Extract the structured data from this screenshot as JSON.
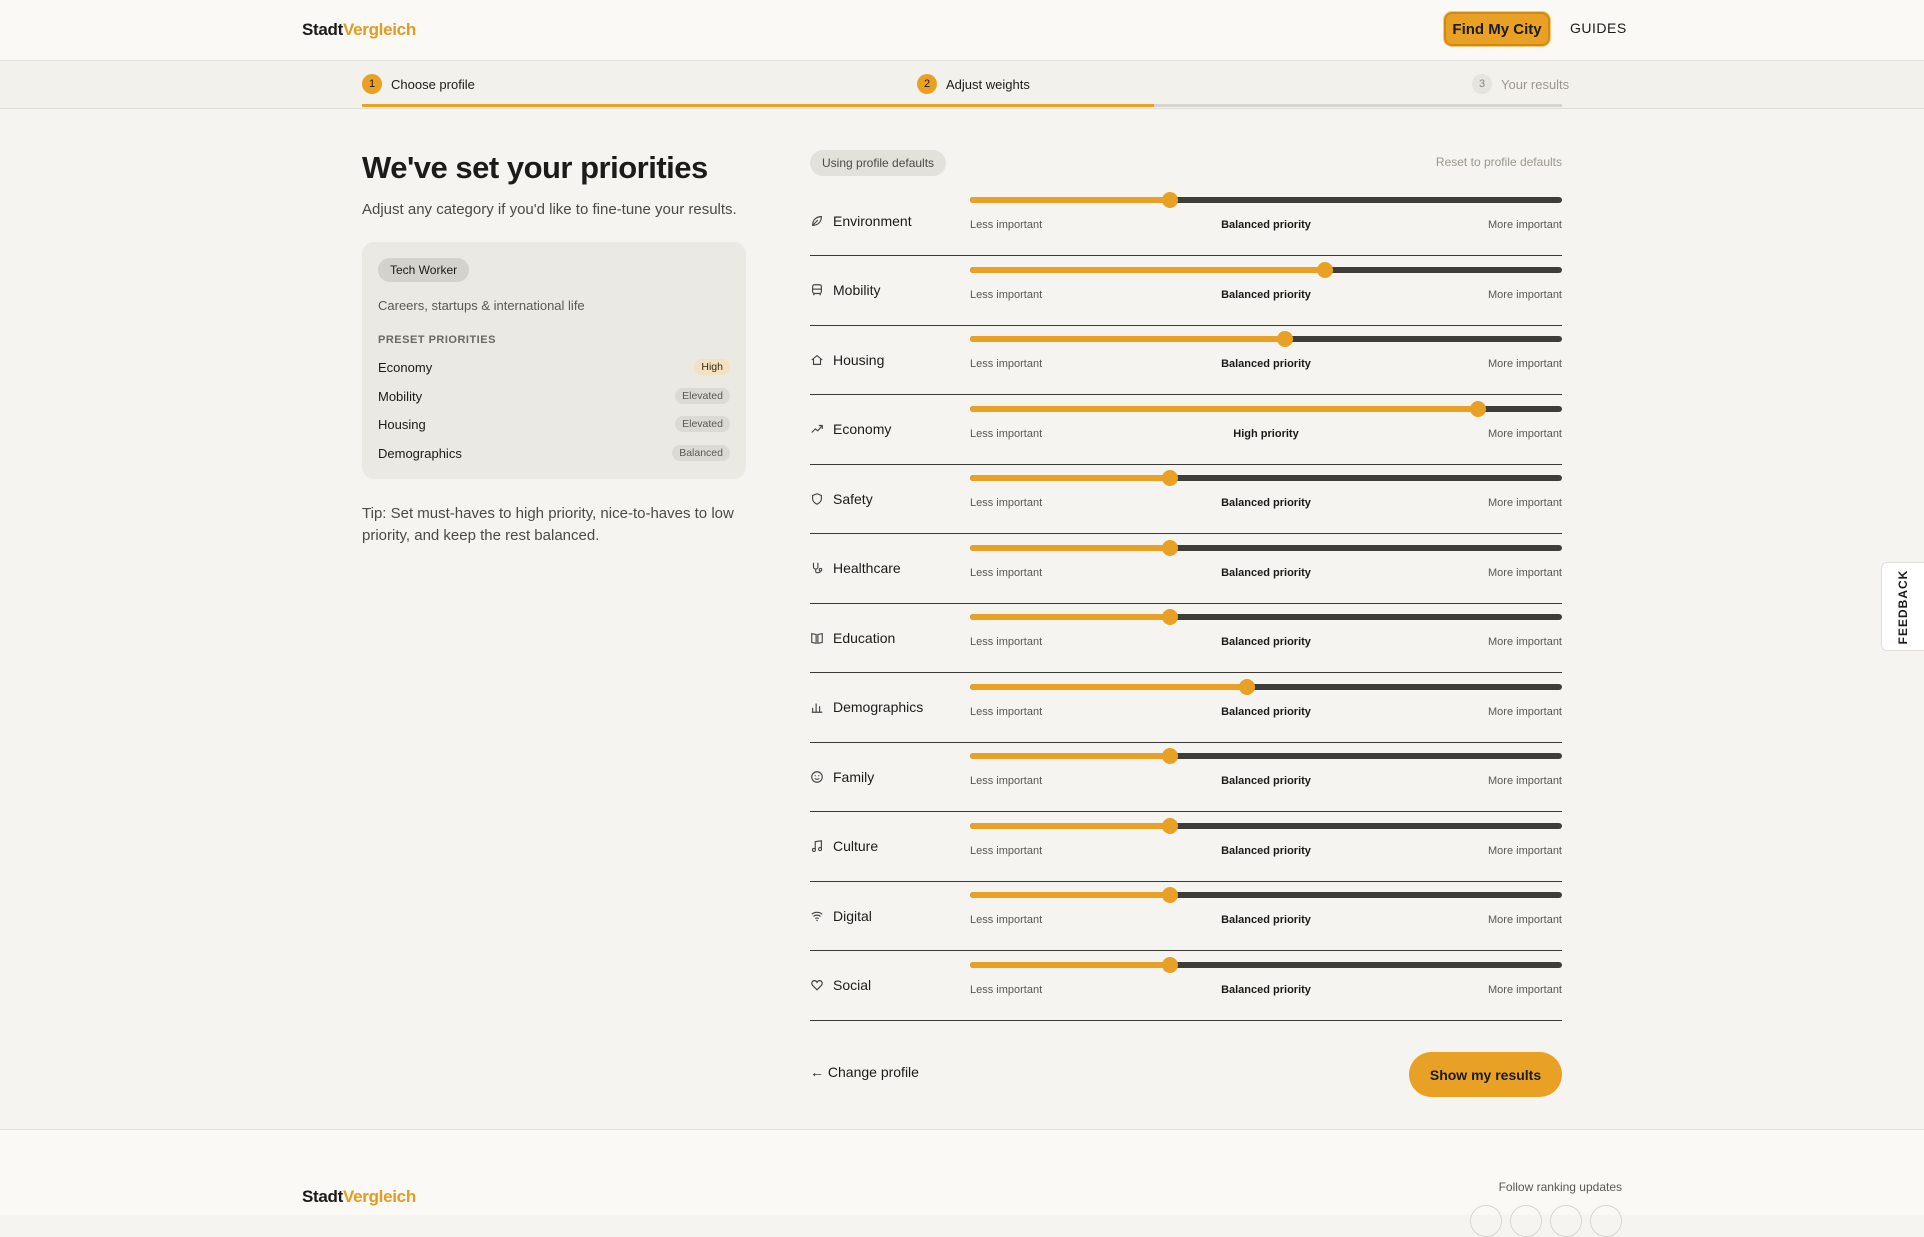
{
  "header": {
    "logo_a": "Stadt",
    "logo_b": "Vergleich",
    "find_label": "Find My City",
    "guides_label": "GUIDES"
  },
  "steps": [
    {
      "num": "1",
      "label": "Choose profile",
      "state": "done"
    },
    {
      "num": "2",
      "label": "Adjust weights",
      "state": "active"
    },
    {
      "num": "3",
      "label": "Your results",
      "state": "upcoming"
    }
  ],
  "progress": 0.66,
  "intro": {
    "title": "We've set your priorities",
    "subtitle": "Adjust any category if you'd like to fine-tune your results."
  },
  "profile": {
    "name": "Tech Worker",
    "description": "Careers, startups & international life",
    "preset_heading": "PRESET PRIORITIES",
    "presets": [
      {
        "label": "Economy",
        "level": "High"
      },
      {
        "label": "Mobility",
        "level": "Elevated"
      },
      {
        "label": "Housing",
        "level": "Elevated"
      },
      {
        "label": "Demographics",
        "level": "Balanced"
      }
    ]
  },
  "tip": "Tip: Set must-haves to high priority, nice-to-haves to low priority, and keep the rest balanced.",
  "weights": {
    "using_label": "Using profile defaults",
    "reset_label": "Reset to profile defaults",
    "less_label": "Less important",
    "more_label": "More important",
    "categories": [
      {
        "name": "Environment",
        "icon": "leaf-icon",
        "value": 0.338,
        "priority": "Balanced priority"
      },
      {
        "name": "Mobility",
        "icon": "train-icon",
        "value": 0.6,
        "priority": "Balanced priority"
      },
      {
        "name": "Housing",
        "icon": "home-icon",
        "value": 0.532,
        "priority": "Balanced priority"
      },
      {
        "name": "Economy",
        "icon": "trend-up-icon",
        "value": 0.858,
        "priority": "High priority"
      },
      {
        "name": "Safety",
        "icon": "shield-icon",
        "value": 0.338,
        "priority": "Balanced priority"
      },
      {
        "name": "Healthcare",
        "icon": "stethoscope-icon",
        "value": 0.338,
        "priority": "Balanced priority"
      },
      {
        "name": "Education",
        "icon": "book-icon",
        "value": 0.338,
        "priority": "Balanced priority"
      },
      {
        "name": "Demographics",
        "icon": "bar-chart-icon",
        "value": 0.468,
        "priority": "Balanced priority"
      },
      {
        "name": "Family",
        "icon": "smile-icon",
        "value": 0.338,
        "priority": "Balanced priority"
      },
      {
        "name": "Culture",
        "icon": "music-icon",
        "value": 0.338,
        "priority": "Balanced priority"
      },
      {
        "name": "Digital",
        "icon": "wifi-icon",
        "value": 0.338,
        "priority": "Balanced priority"
      },
      {
        "name": "Social",
        "icon": "heart-icon",
        "value": 0.338,
        "priority": "Balanced priority"
      }
    ]
  },
  "actions": {
    "change_label": "← Change profile",
    "results_label": "Show my results"
  },
  "feedback_label": "FEEDBACK",
  "footer": {
    "logo_a": "Stadt",
    "logo_b": "Vergleich",
    "follow_label": "Follow ranking updates"
  },
  "colors": {
    "accent": "#e8a125",
    "track": "#3e3d39",
    "background": "#f5f4f0"
  }
}
